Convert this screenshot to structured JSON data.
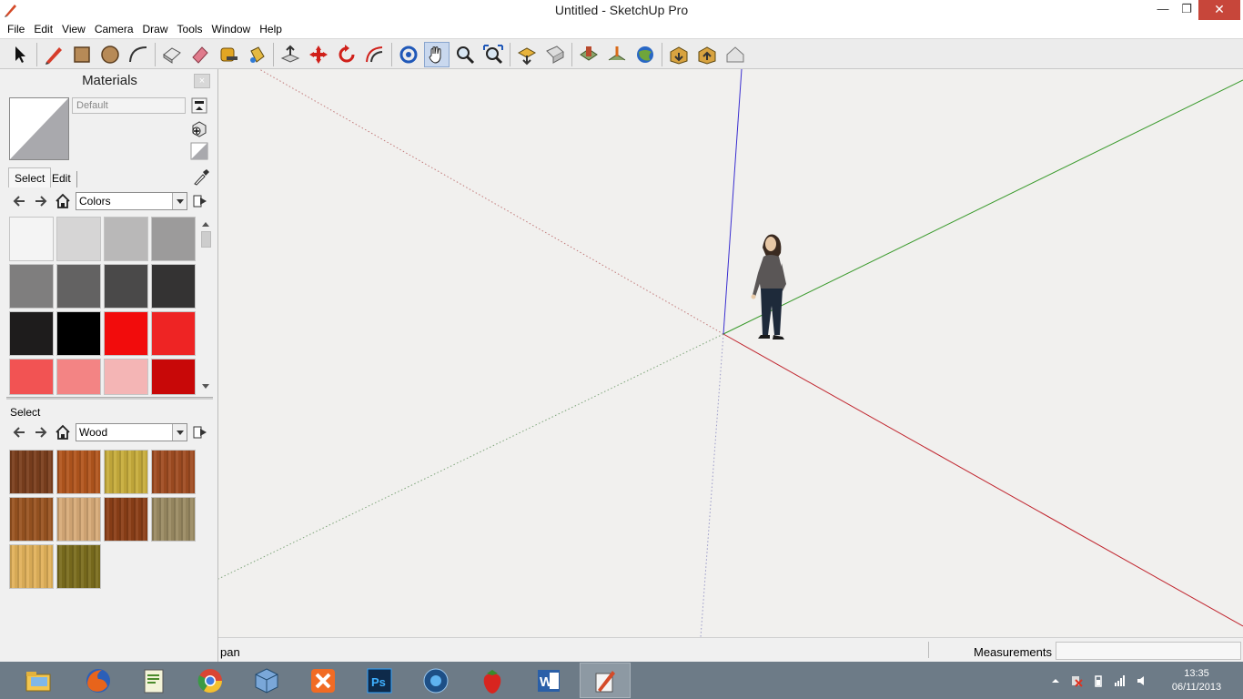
{
  "window": {
    "title": "Untitled - SketchUp Pro",
    "min_glyph": "—",
    "max_glyph": "❐",
    "close_glyph": "✕"
  },
  "menu": [
    "File",
    "Edit",
    "View",
    "Camera",
    "Draw",
    "Tools",
    "Window",
    "Help"
  ],
  "toolbar": {
    "tools": [
      "select-tool",
      "pencil-line-tool",
      "rectangle-tool",
      "circle-tool",
      "arc-tool",
      "make-component-tool",
      "eraser-tool",
      "tape-measure-tool",
      "paint-bucket-tool",
      "push-pull-tool",
      "move-tool",
      "rotate-tool",
      "offset-tool",
      "orbit-tool",
      "pan-tool",
      "zoom-tool",
      "zoom-extents-tool",
      "get-models-tool",
      "share-model-tool",
      "add-location-tool",
      "toggle-terrain-tool",
      "preview-google-earth-tool",
      "get-models-warehouse-tool",
      "share-component-tool",
      "extension-warehouse-tool"
    ],
    "active": "pan-tool"
  },
  "materials": {
    "title": "Materials",
    "close_glyph": "×",
    "current_name": "Default",
    "tab_select": "Select",
    "tab_edit": "Edit",
    "library_top": "Colors",
    "library_bottom": "Wood",
    "section_label": "Select",
    "colors": [
      "#f4f4f4",
      "#d6d5d5",
      "#b9b8b8",
      "#9c9b9b",
      "#7f7e7e",
      "#636262",
      "#4a4949",
      "#343333",
      "#1e1c1c",
      "#000000",
      "#f20c0c",
      "#ee2424",
      "#f25353",
      "#f38484",
      "#f4b5b5",
      "#c80808"
    ],
    "woods": [
      "#7b3f1d",
      "#b3561e",
      "#c8ad3c",
      "#a14d22",
      "#9a5421",
      "#d8ab78",
      "#8c3f17",
      "#9b8b63",
      "#e2b25b",
      "#7b6d1e"
    ]
  },
  "status": {
    "hint": "pan",
    "measurements_label": "Measurements",
    "measurements_value": ""
  },
  "taskbar": {
    "apps": [
      "file-explorer",
      "firefox",
      "text-editor",
      "chrome",
      "virtualbox",
      "xampp",
      "photoshop",
      "media-center",
      "strawberry",
      "word",
      "sketchup"
    ],
    "active": "sketchup",
    "time": "13:35",
    "date": "06/11/2013"
  },
  "colors": {
    "axis_red": "#c0232c",
    "axis_green": "#3a9a2c",
    "axis_blue": "#3a2ed0",
    "close_button": "#c7463a"
  }
}
